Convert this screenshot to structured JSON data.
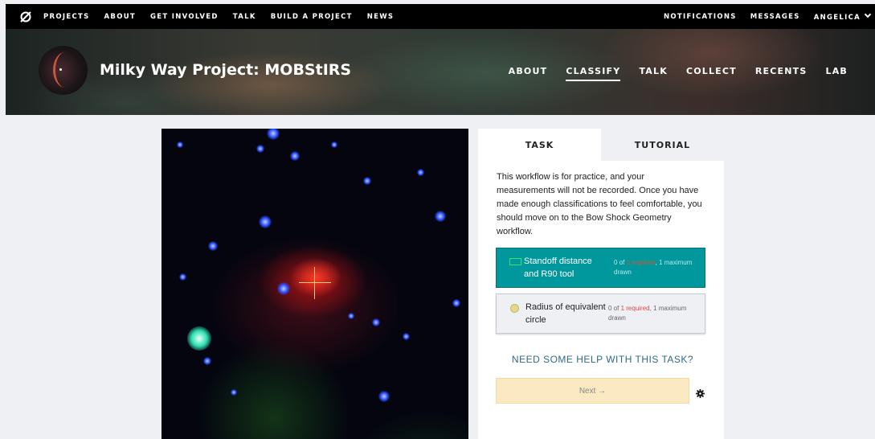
{
  "topnav": {
    "left": [
      "PROJECTS",
      "ABOUT",
      "GET INVOLVED",
      "TALK",
      "BUILD A PROJECT",
      "NEWS"
    ],
    "right": [
      "NOTIFICATIONS",
      "MESSAGES",
      "ANGELICA"
    ],
    "logo_icon": "zooniverse-logo-icon"
  },
  "project": {
    "title": "Milky Way Project: MOBStIRS",
    "nav": [
      "ABOUT",
      "CLASSIFY",
      "TALK",
      "COLLECT",
      "RECENTS",
      "LAB"
    ],
    "active_nav": "CLASSIFY"
  },
  "panel": {
    "tabs": [
      "TASK",
      "TUTORIAL"
    ],
    "instructions": "This workflow is for practice, and your measurements will not be recorded. Once you have made enough classifications to feel comfortable, you should move on to the Bow Shock Geometry workflow.",
    "tools": [
      {
        "label": "Standoff distance and R90 tool",
        "count_prefix": "0 of ",
        "required": "1 required",
        "count_suffix": ", 1 maximum drawn",
        "icon": "rectangle-tool-icon",
        "color": "#00979d"
      },
      {
        "label": "Radius of equivalent circle",
        "count_prefix": "0 of ",
        "required": "1 required",
        "count_suffix": ", 1 maximum drawn",
        "icon": "circle-tool-icon",
        "color": "#e3d98e"
      }
    ],
    "help": "NEED SOME HELP WITH THIS TASK?",
    "next": "Next →"
  },
  "colors": {
    "accent": "#00979d",
    "required": "#e04a4a",
    "next_bg": "#fbe9c2"
  }
}
